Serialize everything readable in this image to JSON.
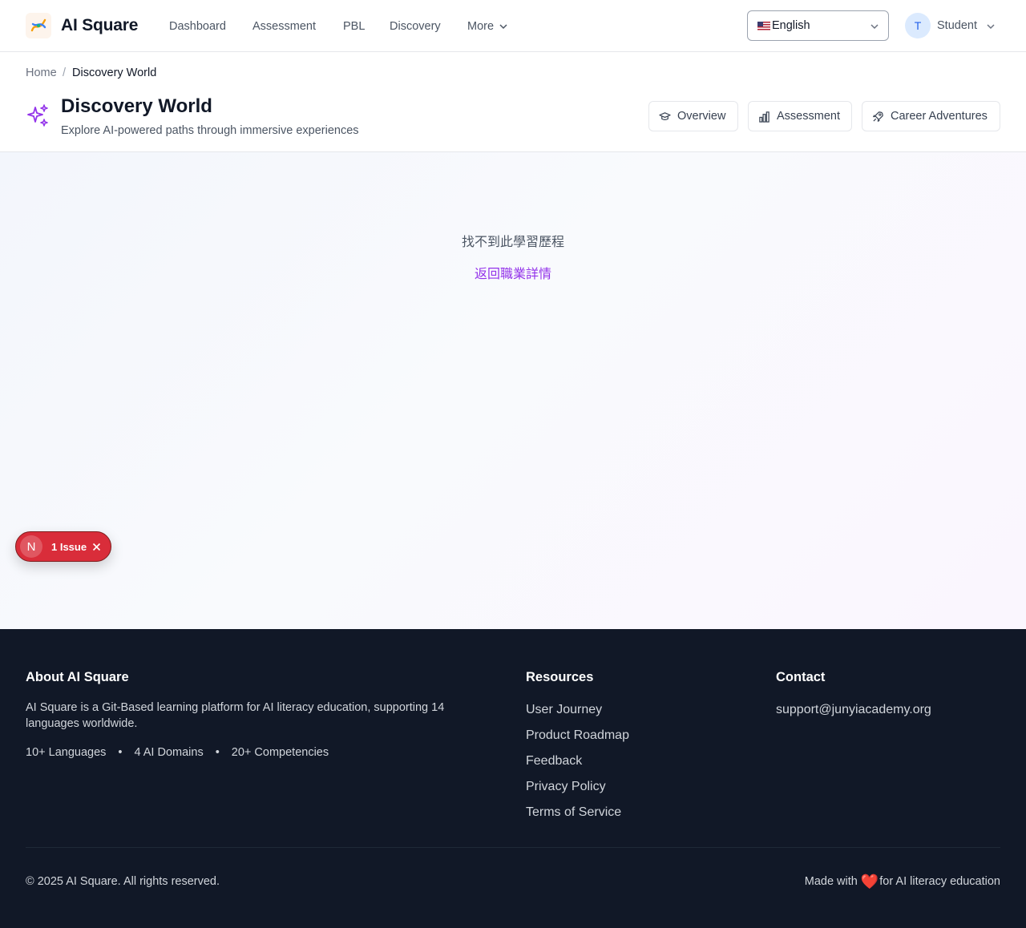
{
  "nav": {
    "brand": "AI Square",
    "links": [
      "Dashboard",
      "Assessment",
      "PBL",
      "Discovery"
    ],
    "more_label": "More",
    "language": "English",
    "user_initial": "T",
    "user_name": "Student"
  },
  "header": {
    "breadcrumb_home": "Home",
    "breadcrumb_sep": "/",
    "breadcrumb_current": "Discovery World",
    "title": "Discovery World",
    "subtitle": "Explore AI-powered paths through immersive experiences",
    "buttons": [
      "Overview",
      "Assessment",
      "Career Adventures"
    ]
  },
  "main": {
    "not_found": "找不到此學習歷程",
    "back_link": "返回職業詳情"
  },
  "issue_badge": {
    "letter": "N",
    "label": "1 Issue"
  },
  "footer": {
    "about_title": "About AI Square",
    "about_text": "AI Square is a Git-Based learning platform for AI literacy education, supporting 14 languages worldwide.",
    "stats": [
      "10+ Languages",
      "4 AI Domains",
      "20+ Competencies"
    ],
    "stat_separator": "•",
    "resources_title": "Resources",
    "resources": [
      "User Journey",
      "Product Roadmap",
      "Feedback",
      "Privacy Policy",
      "Terms of Service"
    ],
    "contact_title": "Contact",
    "contact_email": "support@junyiacademy.org",
    "copyright": "© 2025 AI Square. All rights reserved.",
    "made_with_prefix": "Made with",
    "made_with_suffix": "for AI literacy education"
  },
  "colors": {
    "accent": "#9333ea",
    "footer_bg": "#111827",
    "issue_red": "#d92d3a"
  }
}
